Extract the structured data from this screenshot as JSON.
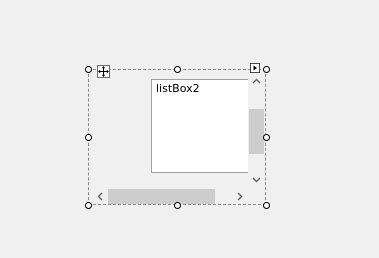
{
  "designer": {
    "listbox": {
      "items": [
        "listBox2"
      ]
    },
    "icons": {
      "move": "move-arrows-icon",
      "smart_tag": "smart-tag-arrow-icon",
      "scroll_up": "chevron-up-icon",
      "scroll_down": "chevron-down-icon",
      "scroll_left": "chevron-left-icon",
      "scroll_right": "chevron-right-icon"
    },
    "colors": {
      "background": "#f0f0f0",
      "listbox_background": "#ffffff",
      "scroll_thumb": "#cdcdcd",
      "selection_border": "#8a8a8a"
    }
  }
}
